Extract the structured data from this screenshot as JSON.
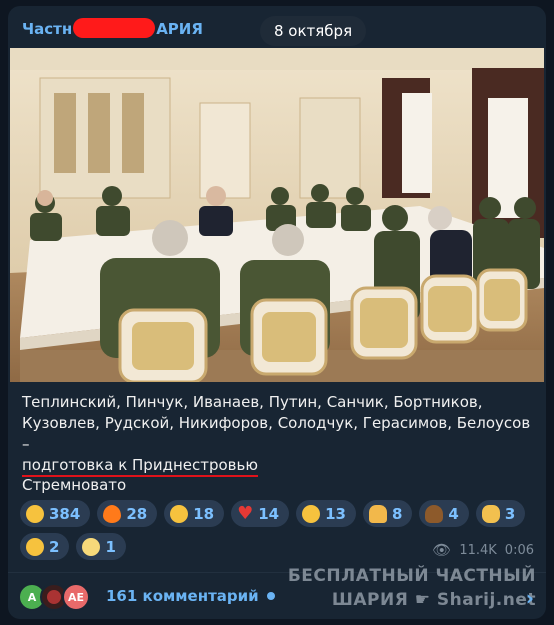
{
  "post": {
    "channel_name_start": "Частн",
    "channel_name_end": "АРИЯ",
    "date": "8 октября",
    "caption_line1": "Теплинский, Пинчук, Иванаев, Путин, Санчик, Бортников,",
    "caption_line2": "Кузовлев, Рудской, Никифоров, Солодчук, Герасимов, Белоусов –",
    "caption_line3": "подготовка к Приднестровью",
    "subtext": "Стремновато",
    "views": "11.4K",
    "duration": "0:06",
    "comments_label": "161 комментарий"
  },
  "reactions": [
    {
      "icon": "thinking-face-icon",
      "count": "384"
    },
    {
      "icon": "fire-icon",
      "count": "28"
    },
    {
      "icon": "crying-face-icon",
      "count": "18"
    },
    {
      "icon": "heart-icon",
      "count": "14"
    },
    {
      "icon": "rofl-icon",
      "count": "13"
    },
    {
      "icon": "praying-hands-icon",
      "count": "8"
    },
    {
      "icon": "poop-icon",
      "count": "4"
    },
    {
      "icon": "ok-hand-icon",
      "count": "3"
    },
    {
      "icon": "grinning-face-icon",
      "count": "2"
    },
    {
      "icon": "screaming-face-icon",
      "count": "1"
    }
  ],
  "avatars": [
    "A",
    "",
    "AE"
  ],
  "watermark": {
    "line1": "БЕСПЛАТНЫЙ ЧАСТНЫЙ",
    "line2_left": "ШАРИЯ",
    "line2_right": "Sharij.net"
  },
  "colors": {
    "background": "#0e1621",
    "card": "#182533",
    "accent": "#6ab3f3",
    "redaction": "#ff1a1a",
    "underline": "#e0121a"
  }
}
